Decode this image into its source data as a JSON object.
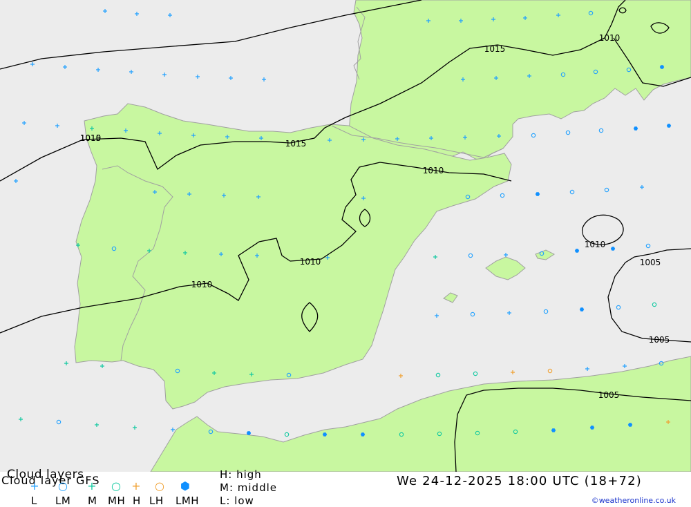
{
  "colors": {
    "sea": "#ececec",
    "land": "#c8f7a0",
    "coast": "#a0a0a0",
    "isobar": "#000000",
    "symbol_L": "#1fa0ff",
    "symbol_LM": "#1fa0ff",
    "symbol_M": "#10c8a0",
    "symbol_MH": "#10c8a0",
    "symbol_H": "#f0a030",
    "symbol_LH": "#f0a030",
    "symbol_LMH": "#1090ff"
  },
  "isobar_labels": [
    "1015",
    "1015",
    "1015",
    "1010",
    "1010",
    "1010",
    "1010",
    "1010",
    "1005",
    "1005",
    "1005",
    "1010"
  ],
  "legend": {
    "title_line1": "Cloud layers",
    "title_line2": "Cloud layer   GFS",
    "categories": [
      {
        "symbol": "+",
        "label": "L",
        "icon": "plus-icon"
      },
      {
        "symbol": "○",
        "label": "LM",
        "icon": "ring-icon"
      },
      {
        "symbol": "+",
        "label": "M",
        "icon": "plus-icon"
      },
      {
        "symbol": "○",
        "label": "MH",
        "icon": "ring-icon"
      },
      {
        "symbol": "+",
        "label": "H",
        "icon": "plus-icon"
      },
      {
        "symbol": "○",
        "label": "LH",
        "icon": "ring-icon"
      },
      {
        "symbol": "⬢",
        "label": "LMH",
        "icon": "hexagon-icon"
      }
    ],
    "levels": [
      "H:  high",
      "M:  middle",
      "L:  low"
    ],
    "datetime": "We 24-12-2025 18:00 UTC (18+72)",
    "copyright": "©weatheronline.co.uk"
  }
}
